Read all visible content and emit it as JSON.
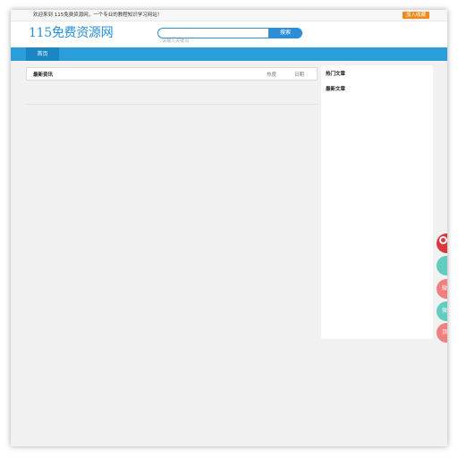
{
  "topbar": {
    "welcome": "欢迎来到 115免费资源网，一个专业的教程知识学习网站！",
    "join_label": "加入收藏"
  },
  "header": {
    "logo": "115免费资源网",
    "search_placeholder": "请输入关键词",
    "search_button": "搜索"
  },
  "nav": {
    "items": [
      {
        "label": "首页"
      }
    ]
  },
  "latest": {
    "title": "最新资讯",
    "columns": {
      "heat": "热度",
      "date": "日期"
    }
  },
  "sidebar": {
    "hot_title": "热门文章",
    "new_title": "最新文章"
  },
  "float_buttons": [
    {
      "label": "",
      "color": "#d9393d"
    },
    {
      "label": "",
      "color": "#63ccc0"
    },
    {
      "label": "微",
      "color": "#f07f7f"
    },
    {
      "label": "微",
      "color": "#63ccc0"
    },
    {
      "label": "顶",
      "color": "#f07f7f"
    }
  ],
  "colors": {
    "brand": "#2a8fd8",
    "nav": "#2a9ed8",
    "nav_active": "#1b86c4",
    "join": "#f08a1c"
  }
}
